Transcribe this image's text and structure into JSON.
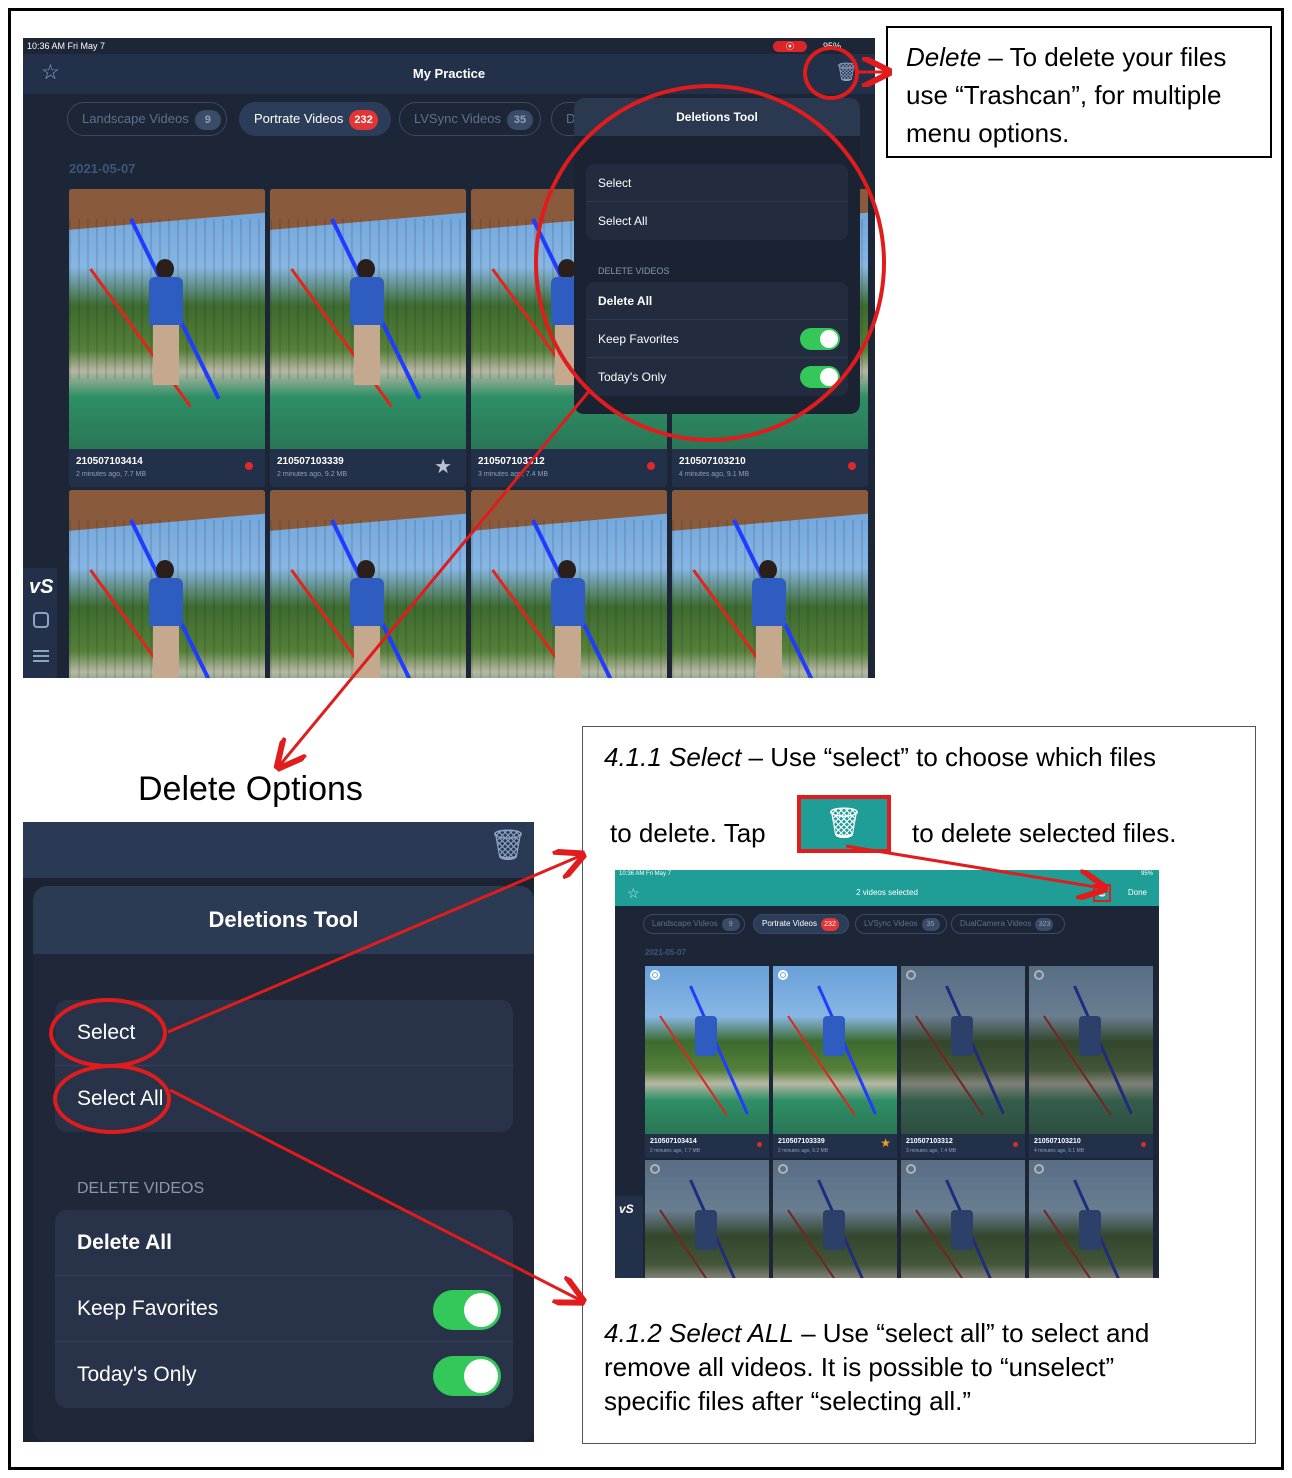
{
  "main": {
    "status_time": "10:36 AM  Fri May 7",
    "battery": "95%",
    "title": "My Practice",
    "tabs": [
      {
        "label": "Landscape Videos",
        "count": "9"
      },
      {
        "label": "Portrate Videos",
        "count": "232"
      },
      {
        "label": "LVSync Videos",
        "count": "35"
      },
      {
        "label": "D",
        "count": ""
      }
    ],
    "date": "2021-05-07",
    "videos": [
      {
        "id": "210507103414",
        "meta": "2 minutes ago, 7.7 MB"
      },
      {
        "id": "210507103339",
        "meta": "2 minutes ago, 9.2 MB"
      },
      {
        "id": "210507103312",
        "meta": "3 minutes ago, 7.4 MB"
      },
      {
        "id": "210507103210",
        "meta": "4 minutes ago, 9.1 MB"
      }
    ],
    "logo": "vS"
  },
  "popover": {
    "title": "Deletions Tool",
    "select": "Select",
    "select_all": "Select All",
    "section": "DELETE VIDEOS",
    "delete_all": "Delete All",
    "keep_favorites": "Keep Favorites",
    "todays_only": "Today's Only",
    "keep_favorites_on": true,
    "todays_only_on": true
  },
  "callout": {
    "term": "Delete",
    "text": " – To delete your files use “Trashcan”, for multiple menu options."
  },
  "zoom_heading": "Delete Options",
  "panel": {
    "p1_term": "4.1.1 Select",
    "p1_a": " – Use “select” to choose which files",
    "p1_b": "to delete. Tap",
    "p1_c": "to delete selected files.",
    "p2_term": "4.1.2 Select ALL",
    "p2_a": " – Use “select all” to select and",
    "p2_b": "remove all videos. It is possible to “unselect”",
    "p2_c": "specific files after “selecting all.”"
  },
  "mini": {
    "status_time": "10:36 AM  Fri May 7",
    "battery": "95%",
    "title": "2 videos selected",
    "done": "Done",
    "tabs": [
      {
        "label": "Landscape Videos",
        "count": "9"
      },
      {
        "label": "Portrate Videos",
        "count": "232"
      },
      {
        "label": "LVSync Videos",
        "count": "35"
      },
      {
        "label": "DualCamera Videos",
        "count": "323"
      }
    ],
    "date": "2021-05-07",
    "videos": [
      {
        "id": "210507103414",
        "meta": "2 minutes ago, 7.7 MB",
        "selected": true
      },
      {
        "id": "210507103339",
        "meta": "2 minutes ago, 9.2 MB",
        "selected": true
      },
      {
        "id": "210507103312",
        "meta": "3 minutes ago, 7.4 MB",
        "selected": false
      },
      {
        "id": "210507103210",
        "meta": "4 minutes ago, 9.1 MB",
        "selected": false
      }
    ],
    "logo": "vS"
  },
  "colors": {
    "annotation_red": "#e01c1c",
    "toggle_green": "#34c759",
    "teal": "#1f9d97",
    "badge_red": "#e23535"
  }
}
